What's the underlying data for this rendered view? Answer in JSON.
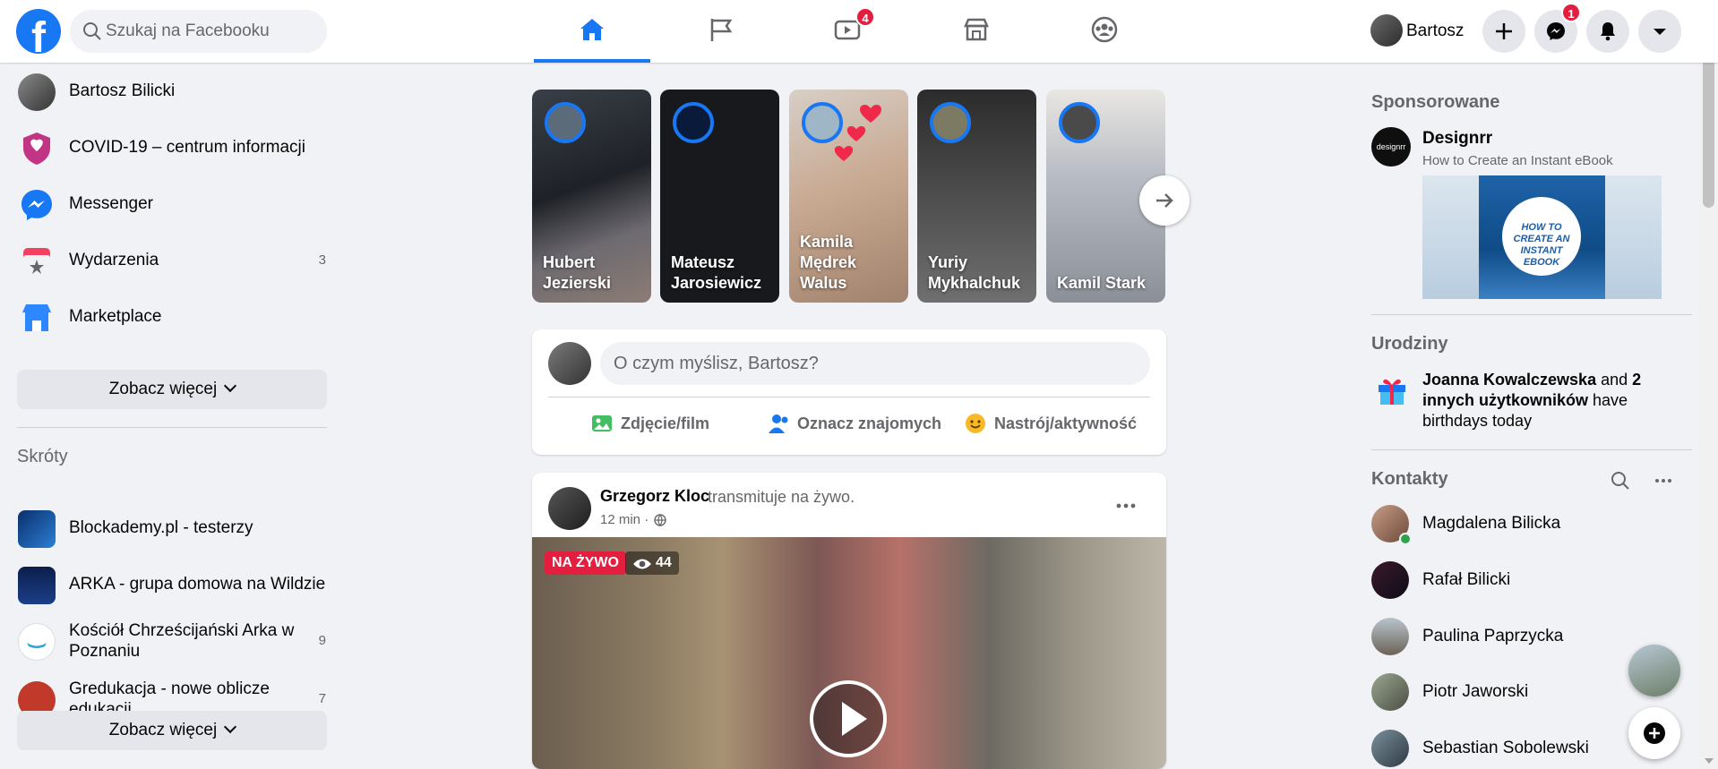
{
  "header": {
    "logo_letter": "f",
    "search_placeholder": "Szukaj na Facebooku",
    "video_badge": "4",
    "profile_name": "Bartosz",
    "messenger_badge": "1",
    "accent_color": "#1877f2",
    "nav_icons": [
      "home-icon",
      "pages-flag-icon",
      "watch-icon",
      "marketplace-icon",
      "groups-icon"
    ]
  },
  "left": {
    "items": [
      {
        "label": "Bartosz Bilicki",
        "icon": "avatar"
      },
      {
        "label": "COVID-19 – centrum informacji",
        "icon": "covid-shield-icon"
      },
      {
        "label": "Messenger",
        "icon": "messenger-icon"
      },
      {
        "label": "Wydarzenia",
        "count": "3",
        "icon": "events-icon"
      },
      {
        "label": "Marketplace",
        "icon": "marketplace-icon"
      }
    ],
    "see_more": "Zobacz więcej",
    "shortcuts_title": "Skróty",
    "shortcuts": [
      {
        "label": "Blockademy.pl - testerzy"
      },
      {
        "label": "ARKA - grupa domowa na Wildzie"
      },
      {
        "label": "Kościół Chrześcijański Arka w Poznaniu",
        "count": "9"
      },
      {
        "label": "Gredukacja - nowe oblicze edukacji",
        "count": "7"
      }
    ],
    "see_more_2": "Zobacz więcej"
  },
  "stories": [
    {
      "name": "Hubert Jezierski"
    },
    {
      "name": "Mateusz Jarosiewicz"
    },
    {
      "name": "Kamila Mędrek Walus"
    },
    {
      "name": "Yuriy Mykhalchuk"
    },
    {
      "name": "Kamil Stark"
    }
  ],
  "composer": {
    "placeholder": "O czym myślisz, Bartosz?",
    "photo": "Zdjęcie/film",
    "tag": "Oznacz znajomych",
    "mood": "Nastrój/aktywność"
  },
  "post": {
    "author": "Grzegorz Kloc",
    "verb": "transmituje na żywo.",
    "time": "12 min ·",
    "live_label": "NA ŻYWO",
    "viewers": "44"
  },
  "right": {
    "sponsored_title": "Sponsorowane",
    "ad_logo": "designrr",
    "ad_name": "Designrr",
    "ad_sub": "How to Create an Instant eBook",
    "ad_book_text": "HOW TO CREATE AN INSTANT EBOOK",
    "birthdays_title": "Urodziny",
    "bday_name": "Joanna Kowalczewska",
    "bday_and": " and ",
    "bday_others": "2 innych użytkowników",
    "bday_rest": " have birthdays today",
    "contacts_title": "Kontakty",
    "contacts": [
      {
        "name": "Magdalena Bilicka"
      },
      {
        "name": "Rafał Bilicki"
      },
      {
        "name": "Paulina Paprzycka"
      },
      {
        "name": "Piotr Jaworski"
      },
      {
        "name": "Sebastian Sobolewski"
      }
    ]
  }
}
